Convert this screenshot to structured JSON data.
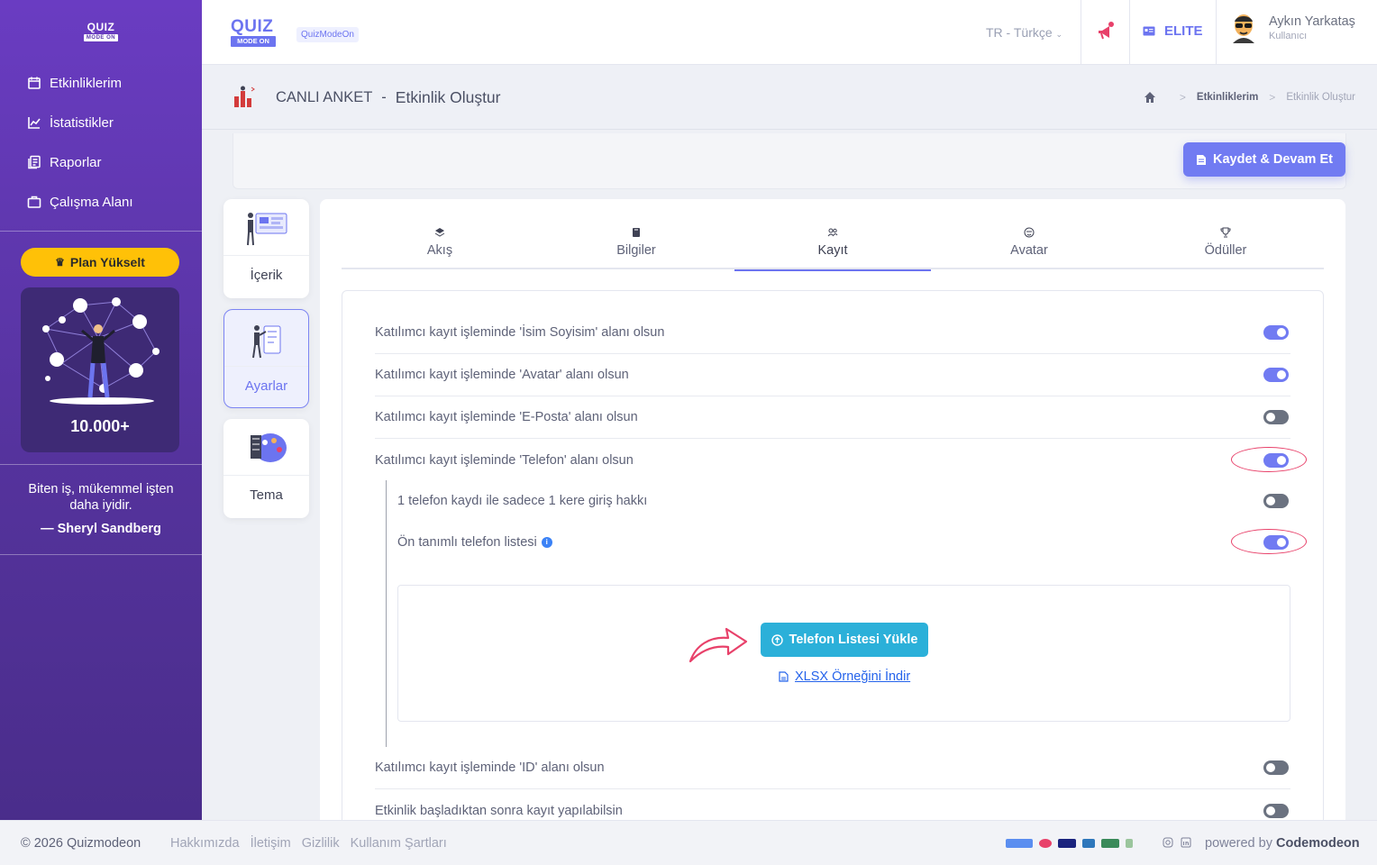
{
  "sidebar": {
    "logo_top": "QUIZ",
    "logo_bottom": "MODE ON",
    "items": [
      {
        "label": "Etkinliklerim",
        "icon": "calendar-icon"
      },
      {
        "label": "İstatistikler",
        "icon": "chart-line-icon"
      },
      {
        "label": "Raporlar",
        "icon": "reports-icon"
      },
      {
        "label": "Çalışma Alanı",
        "icon": "briefcase-icon"
      }
    ],
    "plan_button": "Plan Yükselt",
    "promo_count": "10.000+",
    "quote_text": "Biten iş, mükemmel işten daha iyidir.",
    "quote_author": "— Sheryl Sandberg"
  },
  "topbar": {
    "logo_top": "QUIZ",
    "logo_bottom": "MODE ON",
    "badge": "QuizModeOn",
    "language": "TR - Türkçe",
    "plan": "ELITE",
    "user_name": "Aykın Yarkataş",
    "user_role": "Kullanıcı"
  },
  "subheader": {
    "title": "CANLI ANKET",
    "dash": "-",
    "subtitle": "Etkinlik Oluştur",
    "breadcrumb": [
      "Etkinliklerim",
      "Etkinlik Oluştur"
    ],
    "breadcrumb_sep": ">"
  },
  "toolbar": {
    "save_label": "Kaydet & Devam Et"
  },
  "side_tabs": [
    {
      "label": "İçerik"
    },
    {
      "label": "Ayarlar"
    },
    {
      "label": "Tema"
    }
  ],
  "tabs": [
    {
      "label": "Akış",
      "icon": "layers-icon"
    },
    {
      "label": "Bilgiler",
      "icon": "book-icon"
    },
    {
      "label": "Kayıt",
      "icon": "users-icon"
    },
    {
      "label": "Avatar",
      "icon": "smiley-icon"
    },
    {
      "label": "Ödüller",
      "icon": "trophy-icon"
    }
  ],
  "active_tab": "Kayıt",
  "settings": [
    {
      "label": "Katılımcı kayıt işleminde 'İsim Soyisim' alanı olsun",
      "on": true
    },
    {
      "label": "Katılımcı kayıt işleminde 'Avatar' alanı olsun",
      "on": true
    },
    {
      "label": "Katılımcı kayıt işleminde 'E-Posta' alanı olsun",
      "on": false
    },
    {
      "label": "Katılımcı kayıt işleminde 'Telefon' alanı olsun",
      "on": true
    },
    {
      "label": "1 telefon kaydı ile sadece 1 kere giriş hakkı",
      "on": false
    },
    {
      "label": "Ön tanımlı telefon listesi",
      "on": true
    },
    {
      "label": "Katılımcı kayıt işleminde 'ID' alanı olsun",
      "on": false
    },
    {
      "label": "Etkinlik başladıktan sonra kayıt yapılabilsin",
      "on": false
    }
  ],
  "upload": {
    "button": "Telefon Listesi Yükle",
    "download_link": "XLSX Örneğini İndir"
  },
  "footer": {
    "copyright": "© 2026 Quizmodeon",
    "links": [
      "Hakkımızda",
      "İletişim",
      "Gizlilik",
      "Kullanım Şartları"
    ],
    "powered_prefix": "powered by",
    "powered_brand": "Codemodeon"
  },
  "colors": {
    "accent": "#717bf2",
    "sidebar_top": "#6a3cc2",
    "plan_yellow": "#ffc107",
    "upload_button": "#2bb0d9",
    "highlight_circle": "#e8416a"
  }
}
